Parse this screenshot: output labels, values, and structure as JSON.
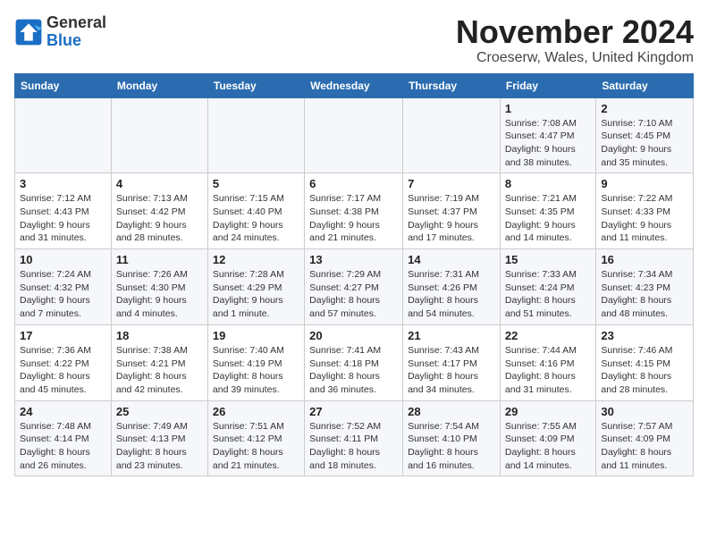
{
  "header": {
    "logo_line1": "General",
    "logo_line2": "Blue",
    "month": "November 2024",
    "location": "Croeserw, Wales, United Kingdom"
  },
  "weekdays": [
    "Sunday",
    "Monday",
    "Tuesday",
    "Wednesday",
    "Thursday",
    "Friday",
    "Saturday"
  ],
  "weeks": [
    [
      {
        "day": "",
        "detail": ""
      },
      {
        "day": "",
        "detail": ""
      },
      {
        "day": "",
        "detail": ""
      },
      {
        "day": "",
        "detail": ""
      },
      {
        "day": "",
        "detail": ""
      },
      {
        "day": "1",
        "detail": "Sunrise: 7:08 AM\nSunset: 4:47 PM\nDaylight: 9 hours\nand 38 minutes."
      },
      {
        "day": "2",
        "detail": "Sunrise: 7:10 AM\nSunset: 4:45 PM\nDaylight: 9 hours\nand 35 minutes."
      }
    ],
    [
      {
        "day": "3",
        "detail": "Sunrise: 7:12 AM\nSunset: 4:43 PM\nDaylight: 9 hours\nand 31 minutes."
      },
      {
        "day": "4",
        "detail": "Sunrise: 7:13 AM\nSunset: 4:42 PM\nDaylight: 9 hours\nand 28 minutes."
      },
      {
        "day": "5",
        "detail": "Sunrise: 7:15 AM\nSunset: 4:40 PM\nDaylight: 9 hours\nand 24 minutes."
      },
      {
        "day": "6",
        "detail": "Sunrise: 7:17 AM\nSunset: 4:38 PM\nDaylight: 9 hours\nand 21 minutes."
      },
      {
        "day": "7",
        "detail": "Sunrise: 7:19 AM\nSunset: 4:37 PM\nDaylight: 9 hours\nand 17 minutes."
      },
      {
        "day": "8",
        "detail": "Sunrise: 7:21 AM\nSunset: 4:35 PM\nDaylight: 9 hours\nand 14 minutes."
      },
      {
        "day": "9",
        "detail": "Sunrise: 7:22 AM\nSunset: 4:33 PM\nDaylight: 9 hours\nand 11 minutes."
      }
    ],
    [
      {
        "day": "10",
        "detail": "Sunrise: 7:24 AM\nSunset: 4:32 PM\nDaylight: 9 hours\nand 7 minutes."
      },
      {
        "day": "11",
        "detail": "Sunrise: 7:26 AM\nSunset: 4:30 PM\nDaylight: 9 hours\nand 4 minutes."
      },
      {
        "day": "12",
        "detail": "Sunrise: 7:28 AM\nSunset: 4:29 PM\nDaylight: 9 hours\nand 1 minute."
      },
      {
        "day": "13",
        "detail": "Sunrise: 7:29 AM\nSunset: 4:27 PM\nDaylight: 8 hours\nand 57 minutes."
      },
      {
        "day": "14",
        "detail": "Sunrise: 7:31 AM\nSunset: 4:26 PM\nDaylight: 8 hours\nand 54 minutes."
      },
      {
        "day": "15",
        "detail": "Sunrise: 7:33 AM\nSunset: 4:24 PM\nDaylight: 8 hours\nand 51 minutes."
      },
      {
        "day": "16",
        "detail": "Sunrise: 7:34 AM\nSunset: 4:23 PM\nDaylight: 8 hours\nand 48 minutes."
      }
    ],
    [
      {
        "day": "17",
        "detail": "Sunrise: 7:36 AM\nSunset: 4:22 PM\nDaylight: 8 hours\nand 45 minutes."
      },
      {
        "day": "18",
        "detail": "Sunrise: 7:38 AM\nSunset: 4:21 PM\nDaylight: 8 hours\nand 42 minutes."
      },
      {
        "day": "19",
        "detail": "Sunrise: 7:40 AM\nSunset: 4:19 PM\nDaylight: 8 hours\nand 39 minutes."
      },
      {
        "day": "20",
        "detail": "Sunrise: 7:41 AM\nSunset: 4:18 PM\nDaylight: 8 hours\nand 36 minutes."
      },
      {
        "day": "21",
        "detail": "Sunrise: 7:43 AM\nSunset: 4:17 PM\nDaylight: 8 hours\nand 34 minutes."
      },
      {
        "day": "22",
        "detail": "Sunrise: 7:44 AM\nSunset: 4:16 PM\nDaylight: 8 hours\nand 31 minutes."
      },
      {
        "day": "23",
        "detail": "Sunrise: 7:46 AM\nSunset: 4:15 PM\nDaylight: 8 hours\nand 28 minutes."
      }
    ],
    [
      {
        "day": "24",
        "detail": "Sunrise: 7:48 AM\nSunset: 4:14 PM\nDaylight: 8 hours\nand 26 minutes."
      },
      {
        "day": "25",
        "detail": "Sunrise: 7:49 AM\nSunset: 4:13 PM\nDaylight: 8 hours\nand 23 minutes."
      },
      {
        "day": "26",
        "detail": "Sunrise: 7:51 AM\nSunset: 4:12 PM\nDaylight: 8 hours\nand 21 minutes."
      },
      {
        "day": "27",
        "detail": "Sunrise: 7:52 AM\nSunset: 4:11 PM\nDaylight: 8 hours\nand 18 minutes."
      },
      {
        "day": "28",
        "detail": "Sunrise: 7:54 AM\nSunset: 4:10 PM\nDaylight: 8 hours\nand 16 minutes."
      },
      {
        "day": "29",
        "detail": "Sunrise: 7:55 AM\nSunset: 4:09 PM\nDaylight: 8 hours\nand 14 minutes."
      },
      {
        "day": "30",
        "detail": "Sunrise: 7:57 AM\nSunset: 4:09 PM\nDaylight: 8 hours\nand 11 minutes."
      }
    ]
  ]
}
